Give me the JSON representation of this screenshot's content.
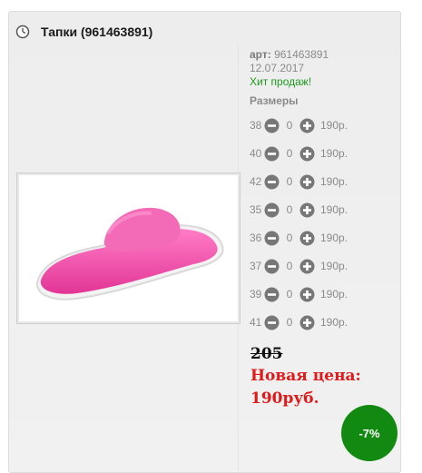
{
  "product": {
    "title": "Тапки (961463891)",
    "art_label": "арт:",
    "art_value": "961463891",
    "date": "12.07.2017",
    "hit": "Хит продаж!",
    "sizes_title": "Размеры",
    "sizes": [
      {
        "size": "38",
        "qty": "0",
        "price": "190р."
      },
      {
        "size": "40",
        "qty": "0",
        "price": "190р."
      },
      {
        "size": "42",
        "qty": "0",
        "price": "190р."
      },
      {
        "size": "35",
        "qty": "0",
        "price": "190р."
      },
      {
        "size": "36",
        "qty": "0",
        "price": "190р."
      },
      {
        "size": "37",
        "qty": "0",
        "price": "190р."
      },
      {
        "size": "39",
        "qty": "0",
        "price": "190р."
      },
      {
        "size": "41",
        "qty": "0",
        "price": "190р."
      }
    ],
    "old_price": "205",
    "new_price_label": "Новая цена:",
    "new_price_value": "190руб.",
    "discount": "-7%"
  },
  "colors": {
    "hit_green": "#1d9a1d",
    "new_price_red": "#e01a1a",
    "badge_green": "#128a12",
    "slipper_pink": "#f04aa6"
  },
  "icons": {
    "title": "clock-icon",
    "minus": "minus-circle-icon",
    "plus": "plus-circle-icon"
  }
}
